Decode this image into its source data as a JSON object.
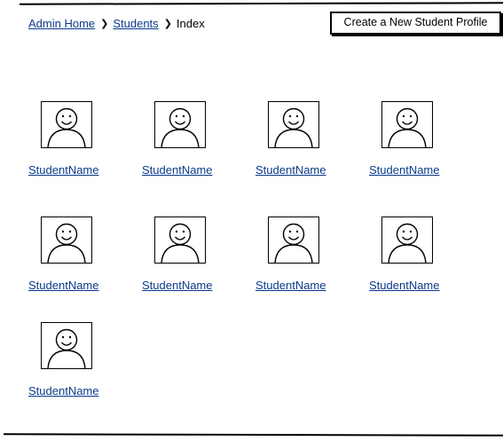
{
  "breadcrumb": {
    "items": [
      "Admin Home",
      "Students"
    ],
    "current": "Index"
  },
  "actions": {
    "create_label": "Create a New Student Profile"
  },
  "students": [
    {
      "name": "StudentName",
      "icon": "user-avatar-icon"
    },
    {
      "name": "StudentName",
      "icon": "user-avatar-icon"
    },
    {
      "name": "StudentName",
      "icon": "user-avatar-icon"
    },
    {
      "name": "StudentName",
      "icon": "user-avatar-icon"
    },
    {
      "name": "StudentName",
      "icon": "user-avatar-icon"
    },
    {
      "name": "StudentName",
      "icon": "user-avatar-icon"
    },
    {
      "name": "StudentName",
      "icon": "user-avatar-icon"
    },
    {
      "name": "StudentName",
      "icon": "user-avatar-icon"
    },
    {
      "name": "StudentName",
      "icon": "user-avatar-icon"
    }
  ],
  "colors": {
    "link": "#0b3a8a",
    "border": "#000000"
  }
}
